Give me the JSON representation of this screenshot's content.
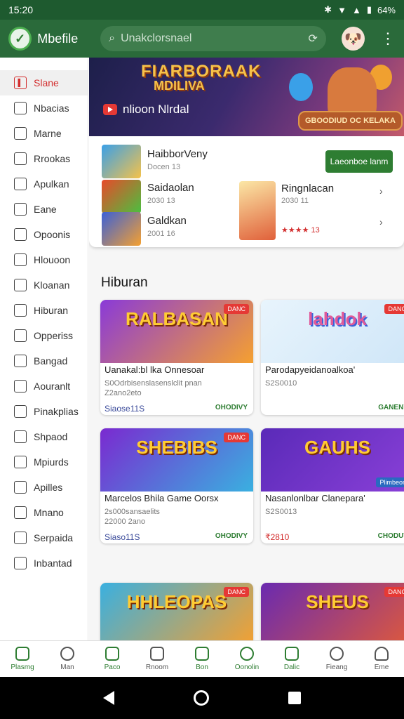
{
  "status_bar": {
    "time": "15:20",
    "battery": "64%"
  },
  "app_bar": {
    "title": "Mbefile",
    "search_placeholder": "Unakclorsnael"
  },
  "sidebar": {
    "items": [
      {
        "label": "Slane",
        "icon": "bar-chart-icon"
      },
      {
        "label": "Nbacias",
        "icon": "book-icon"
      },
      {
        "label": "Marne",
        "icon": "chat-icon"
      },
      {
        "label": "Rrookas",
        "icon": "tools-icon"
      },
      {
        "label": "Apulkan",
        "icon": "chart-icon"
      },
      {
        "label": "Eane",
        "icon": "list-icon"
      },
      {
        "label": "Opoonis",
        "icon": "folder-icon"
      },
      {
        "label": "Hlouoon",
        "icon": "people-icon"
      },
      {
        "label": "Kloanan",
        "icon": "grid-icon"
      },
      {
        "label": "Hiburan",
        "icon": "tv-icon"
      },
      {
        "label": "Opperiss",
        "icon": "edit-icon"
      },
      {
        "label": "Bangad",
        "icon": "search-icon"
      },
      {
        "label": "Aouranlt",
        "icon": "tablet-icon"
      },
      {
        "label": "Pinakplias",
        "icon": "doc-icon"
      },
      {
        "label": "Shpaod",
        "icon": "card-icon"
      },
      {
        "label": "Mpiurds",
        "icon": "tag-icon"
      },
      {
        "label": "Apilles",
        "icon": "calendar-icon"
      },
      {
        "label": "Mnano",
        "icon": "camera-icon"
      },
      {
        "label": "Serpaida",
        "icon": "pen-icon"
      },
      {
        "label": "Inbantad",
        "icon": "link-icon"
      }
    ]
  },
  "hero": {
    "title": "FIARBORAAK",
    "subtitle": "MDILIVA",
    "channel": "nlioon Nlrdal",
    "badge": "GBOODIUD OC KELAKA"
  },
  "featured": {
    "install_label": "Laeonboe lanm",
    "apps": [
      {
        "title": "HaibborVeny",
        "sub": "Docen 13"
      },
      {
        "title": "Saidaolan",
        "sub": "2030 13"
      },
      {
        "title": "Galdkan",
        "sub": "2001 16"
      },
      {
        "title": "Ringnlacan",
        "sub": "2030 11",
        "rating": "★★★★ 13"
      }
    ]
  },
  "section": {
    "title": "Hiburan"
  },
  "cards": [
    {
      "art": "RALBASAN",
      "tag": "DANC",
      "title": "Uanakal:bl lka Onnesoar",
      "sub1": "S0Odrbisenslasenslclit pnan",
      "sub2": "Z2ano2eto",
      "price": "Siaose11S",
      "cta": "OHODIVY"
    },
    {
      "art": "lahdok",
      "tag": "DANC",
      "title": "Parodapyeidanoalkoa'",
      "sub1": "S2S0010",
      "sub2": "",
      "price": "",
      "cta": "GANENY"
    },
    {
      "art": "SHEBIBS",
      "tag": "DANC",
      "title": "Marcelos Bhila Game Oorsx",
      "sub1": "2s000sansaelits",
      "sub2": "22000 2ano",
      "price": "Siaso11S",
      "cta": "OHODIVY"
    },
    {
      "art": "GAUHS",
      "tag": "Plimbeon",
      "title": "Nasanlonlbar Clanepara'",
      "sub1": "S2S0013",
      "sub2": "",
      "price": "₹2810",
      "cta": "CHODUV"
    },
    {
      "art": "HHLEOPAS",
      "tag": "DANC",
      "title": "",
      "sub1": "",
      "sub2": "",
      "price": "",
      "cta": ""
    },
    {
      "art": "SHEUS",
      "tag": "DANC",
      "title": "",
      "sub1": "",
      "sub2": "",
      "price": "",
      "cta": ""
    }
  ],
  "bottom_nav": [
    {
      "label": "Plasmg",
      "green": true
    },
    {
      "label": "Man",
      "green": false
    },
    {
      "label": "Paco",
      "green": true
    },
    {
      "label": "Rnoom",
      "green": false
    },
    {
      "label": "Bon",
      "green": true
    },
    {
      "label": "Oonolin",
      "green": true
    },
    {
      "label": "Dalic",
      "green": true
    },
    {
      "label": "Fieang",
      "green": false
    },
    {
      "label": "Eme",
      "green": false
    }
  ],
  "colors": {
    "primary": "#2a6a3a",
    "accent": "#2e7d32",
    "active": "#d32f2f"
  }
}
